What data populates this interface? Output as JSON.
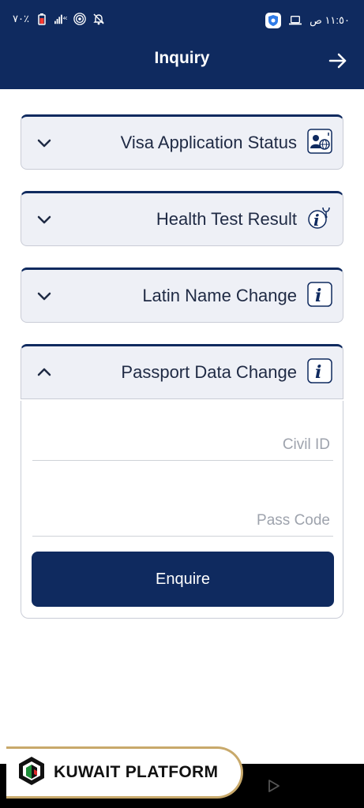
{
  "status_bar": {
    "time": "١١:٥٠ ص",
    "battery": "٧٠٪"
  },
  "header": {
    "title": "Inquiry"
  },
  "accordions": [
    {
      "label": "Visa Application Status",
      "icon": "visa-card-globe-icon",
      "expanded": false
    },
    {
      "label": "Health Test Result",
      "icon": "info-stethoscope-icon",
      "expanded": false
    },
    {
      "label": "Latin Name Change",
      "icon": "info-icon",
      "expanded": false
    },
    {
      "label": "Passport Data Change",
      "icon": "info-icon",
      "expanded": true
    }
  ],
  "form": {
    "civil_id": {
      "placeholder": "Civil ID",
      "value": ""
    },
    "pass_code": {
      "placeholder": "Pass Code",
      "value": ""
    },
    "submit_label": "Enquire"
  },
  "brand": {
    "name": "KUWAIT PLATFORM"
  },
  "colors": {
    "primary": "#0f2a5f",
    "panel_bg": "#eef0f6",
    "brand_gold": "#c8a96b"
  }
}
